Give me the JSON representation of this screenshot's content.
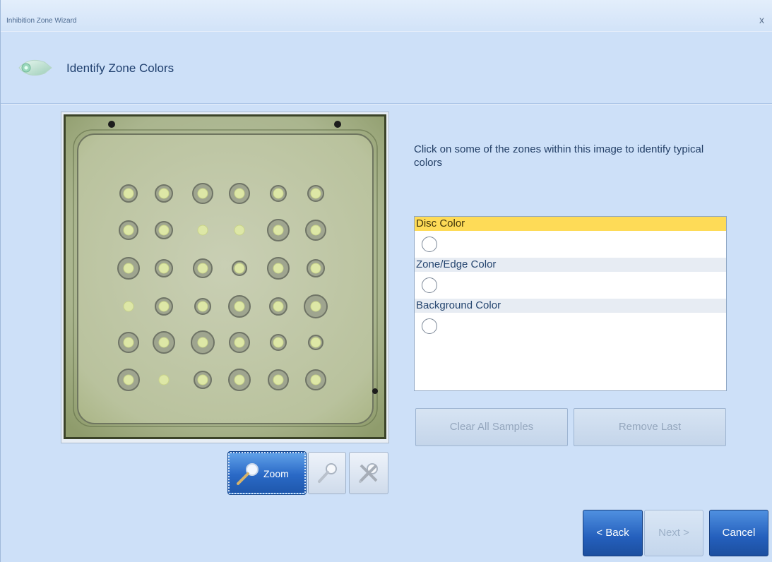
{
  "window": {
    "title": "Inhibition Zone Wizard",
    "close_label": "x"
  },
  "header": {
    "title": "Identify Zone Colors",
    "icon": "wizard-step-disc-icon"
  },
  "instructions": "Click on some of the zones within this image to identify typical colors",
  "color_groups": [
    {
      "label": "Disc Color",
      "selected": true
    },
    {
      "label": "Zone/Edge Color",
      "selected": false
    },
    {
      "label": "Background Color",
      "selected": false
    }
  ],
  "image_tools": {
    "zoom_label": "Zoom",
    "zoom_icon": "zoom-magnifier-icon",
    "pick_icon": "color-picker-icon",
    "remove_icon": "remove-sample-icon"
  },
  "buttons": {
    "clear_all": "Clear All Samples",
    "remove_last": "Remove Last",
    "back": "< Back",
    "next": "Next >",
    "cancel": "Cancel"
  },
  "colors": {
    "accent": "#2a69c6",
    "selection": "#fedb57",
    "background": "#cde0f8"
  }
}
